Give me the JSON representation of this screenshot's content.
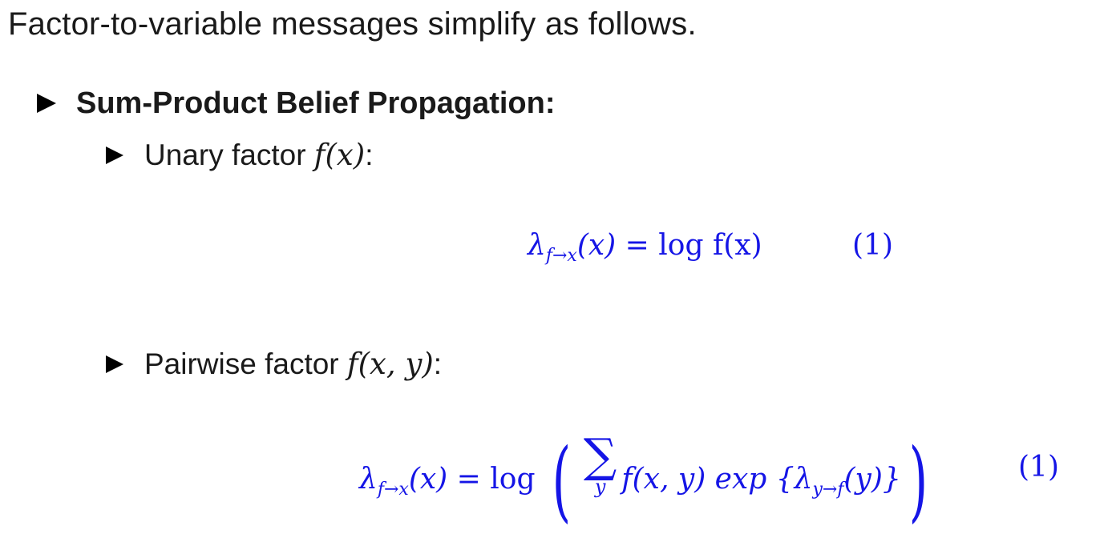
{
  "intro": "Factor-to-variable messages simplify as follows.",
  "section": {
    "heading": "Sum-Product Belief Propagation:",
    "items": [
      {
        "label": "Unary factor ",
        "math": "f(x)",
        "suffix": ":",
        "equation": {
          "lhs": "λ",
          "lhs_sub": "f→x",
          "lhs_arg": "(x)",
          "rhs": "= log f(x)",
          "number": "(1)"
        }
      },
      {
        "label": "Pairwise factor ",
        "math": "f(x, y)",
        "suffix": ":",
        "equation": {
          "lhs": "λ",
          "lhs_sub": "f→x",
          "lhs_arg": "(x)",
          "op": "= log",
          "sum_var": "y",
          "body": "f(x, y) exp {λ",
          "body_sub": "y→f",
          "body_end": "(y)}",
          "number": "(1)"
        }
      }
    ]
  },
  "colors": {
    "text": "#1a1a1a",
    "equation": "#1515e6",
    "bullet": "#000000"
  }
}
